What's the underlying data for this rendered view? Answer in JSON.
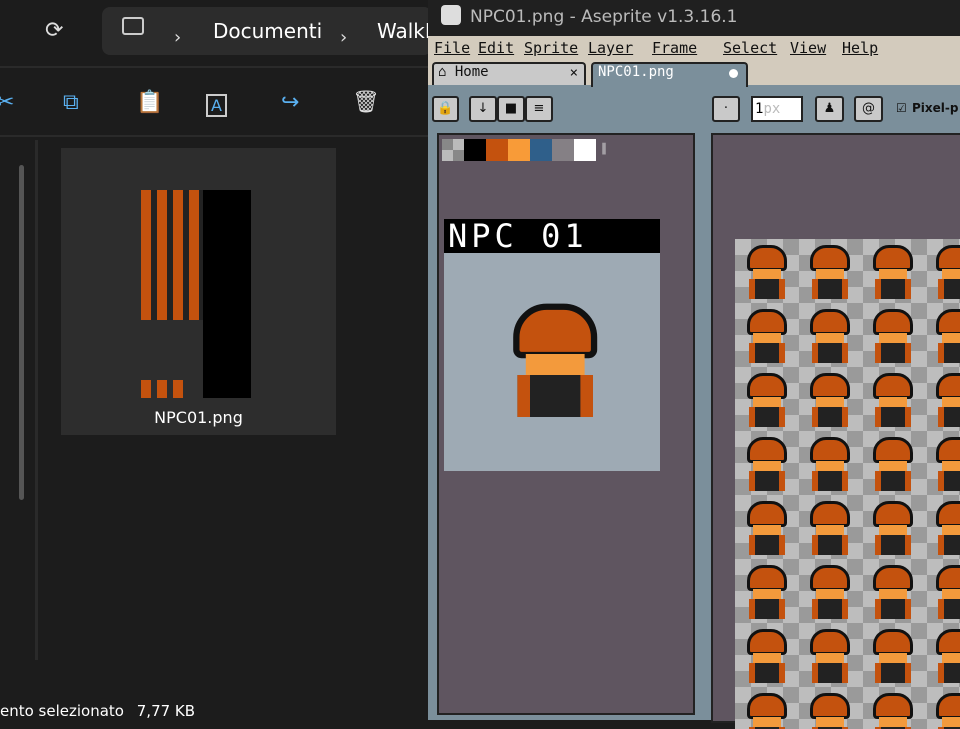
{
  "explorer": {
    "breadcrumb": [
      "Documenti",
      "WalkE"
    ],
    "toolbar_icons": [
      "cut-icon",
      "copy-icon",
      "paste-icon",
      "rename-icon",
      "share-icon",
      "delete-icon"
    ],
    "file": {
      "name": "NPC01.png"
    },
    "status": {
      "selection": "ento selezionato",
      "size": "7,77 KB"
    }
  },
  "aseprite": {
    "title": "NPC01.png - Aseprite v1.3.16.1",
    "menu": [
      "File",
      "Edit",
      "Sprite",
      "Layer",
      "Frame",
      "Select",
      "View",
      "Help"
    ],
    "tabs": [
      {
        "label": "Home",
        "active": false
      },
      {
        "label": "NPC01.png",
        "active": true,
        "modified": true
      }
    ],
    "toolbar": {
      "brush_size": "1",
      "brush_unit": "px",
      "pixel_perfect_label": "Pixel-p"
    },
    "palette": [
      "#000000",
      "#c4520e",
      "#f89b38",
      "#2f5f8a",
      "#858085",
      "#ffffff"
    ],
    "preview_banner": "NPC 01"
  }
}
